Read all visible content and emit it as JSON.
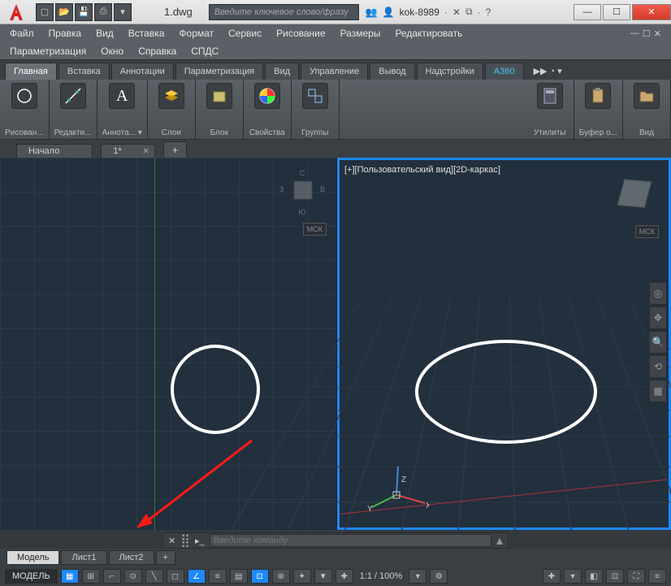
{
  "titlebar": {
    "filename": "1.dwg",
    "search_placeholder": "Введите ключевое слово/фразу",
    "username": "kok-8989"
  },
  "menu1": [
    "Файл",
    "Правка",
    "Вид",
    "Вставка",
    "Формат",
    "Сервис",
    "Рисование",
    "Размеры",
    "Редактировать"
  ],
  "menu2": [
    "Параметризация",
    "Окно",
    "Справка",
    "СПДС"
  ],
  "ribbon_tabs": [
    "Главная",
    "Вставка",
    "Аннотации",
    "Параметризация",
    "Вид",
    "Управление",
    "Вывод",
    "Надстройки",
    "A360"
  ],
  "ribbon_extra": "▶▶ ◔ ▾",
  "panels": {
    "draw": "Рисован...",
    "edit": "Редакти...",
    "annot": "Аннота... ▾",
    "layers": "Слои",
    "block": "Блок",
    "props": "Свойства",
    "groups": "Группы",
    "utils": "Утилиты",
    "clipboard": "Буфер о...",
    "view": "Вид"
  },
  "file_tabs": {
    "start": "Начало",
    "doc": "1*",
    "add": "+"
  },
  "viewport": {
    "right_label": "[+][Пользовательский вид][2D-каркас]",
    "wcs": "МСК",
    "left_cube": {
      "n": "С",
      "s": "Ю",
      "e": "В",
      "w": "З",
      "top": "top"
    },
    "ucs": {
      "x": "X",
      "y": "Y",
      "z": "Z"
    }
  },
  "cmdline": {
    "placeholder": "Введите команду"
  },
  "layout_tabs": {
    "model": "Модель",
    "l1": "Лист1",
    "l2": "Лист2",
    "add": "+"
  },
  "status": {
    "model": "МОДЕЛЬ",
    "scale": "1:1 / 100%"
  }
}
